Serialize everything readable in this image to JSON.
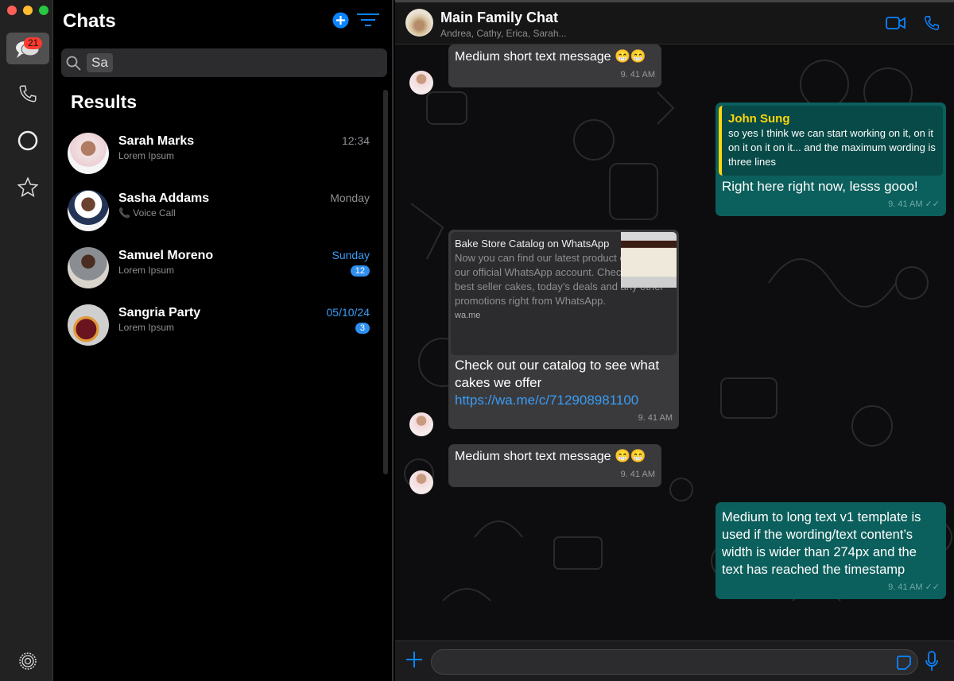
{
  "rail": {
    "chats_badge": "21"
  },
  "list": {
    "title": "Chats",
    "search_value": "Sa",
    "results_heading": "Results",
    "items": [
      {
        "name": "Sarah Marks",
        "preview": "Lorem Ipsum",
        "time": "12:34",
        "unread": null
      },
      {
        "name": "Sasha Addams",
        "preview": "Voice Call",
        "time": "Monday",
        "unread": null
      },
      {
        "name": "Samuel Moreno",
        "preview": "Lorem Ipsum",
        "time": "Sunday",
        "unread": "12"
      },
      {
        "name": "Sangria Party",
        "preview": "Lorem Ipsum",
        "time": "05/10/24",
        "unread": "3"
      }
    ]
  },
  "chat": {
    "title": "Main Family Chat",
    "members": "Andrea, Cathy, Erica, Sarah...",
    "messages": [
      {
        "text": "Medium short text message 😁😁",
        "time": "9. 41 AM"
      },
      {
        "quote_author": "John Sung",
        "quote_text": "so yes I think we can start working on it, on it on it on it on it... and the maximum wording is three lines",
        "text": "Right here right now, lesss gooo!",
        "time": "9. 41 AM"
      },
      {
        "link_title": "Bake Store Catalog on WhatsApp",
        "link_desc": "Now you can find our latest product catalog on our official WhatsApp account. Check out our best seller cakes, today’s deals and any other promotions right from WhatsApp.",
        "link_domain": "wa.me",
        "text": "Check out our catalog to see what cakes we offer",
        "url": "https://wa.me/c/712908981100",
        "time": "9. 41 AM"
      },
      {
        "text": "Medium short text message 😁😁",
        "time": "9. 41 AM"
      },
      {
        "text": "Medium to long text v1 template is used if the wording/text content’s width is wider than 274px and the text has reached the timestamp",
        "time": "9. 41 AM"
      }
    ]
  },
  "composer": {
    "placeholder": ""
  },
  "colors": {
    "accent": "#0a84ff",
    "outgoing": "#0b5f5c",
    "incoming": "#3a3a3c",
    "quote_author": "#ffd60a"
  }
}
